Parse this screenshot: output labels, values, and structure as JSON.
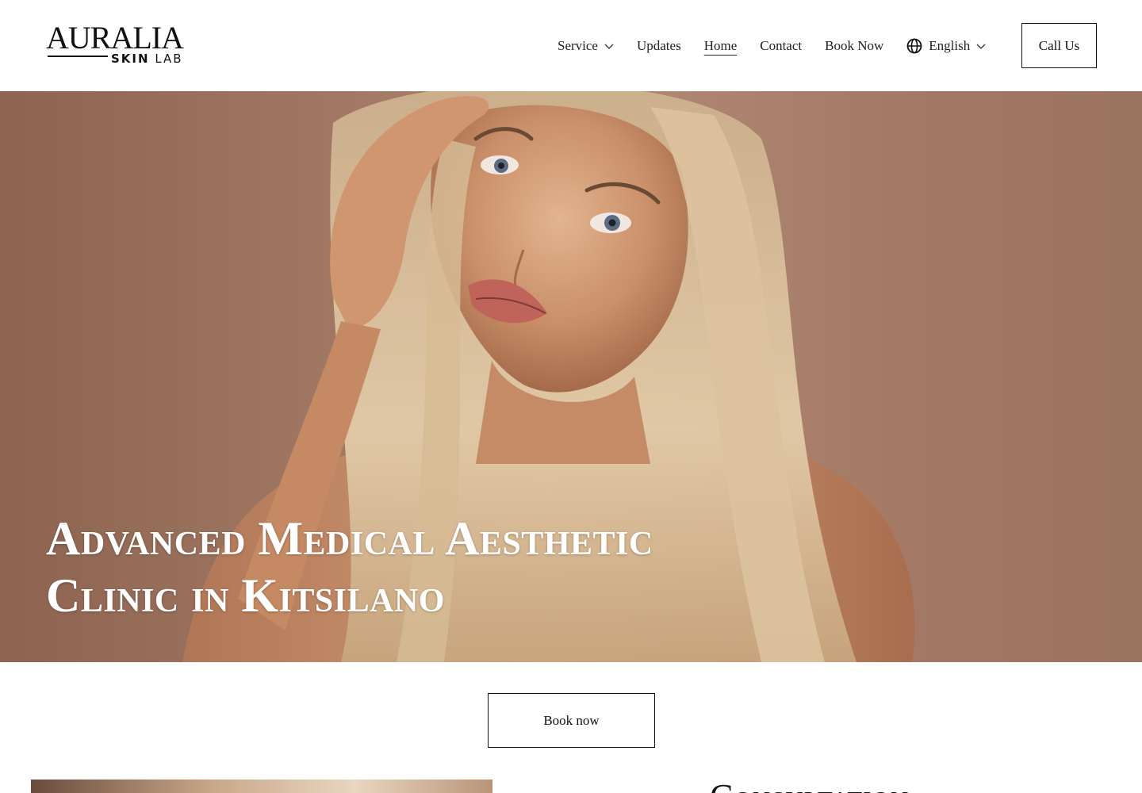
{
  "brand": {
    "name": "AURALIA",
    "sub_bold": "SKIN",
    "sub_light": "LAB"
  },
  "nav": {
    "items": [
      {
        "label": "Service",
        "has_dropdown": true
      },
      {
        "label": "Updates"
      },
      {
        "label": "Home",
        "active": true
      },
      {
        "label": "Contact"
      },
      {
        "label": "Book Now"
      }
    ],
    "language": {
      "label": "English",
      "icon": "globe-icon"
    }
  },
  "header": {
    "call_label": "Call Us"
  },
  "hero": {
    "title_line1": "Advanced Medical Aesthetic",
    "title_line2": "Clinic in Kitsilano"
  },
  "cta": {
    "book_label": "Book now"
  },
  "next_section": {
    "heading": "Consultation"
  },
  "colors": {
    "text": "#111111",
    "hero_bg": "#a07864",
    "hero_text": "#ffffff",
    "background": "#ffffff"
  }
}
